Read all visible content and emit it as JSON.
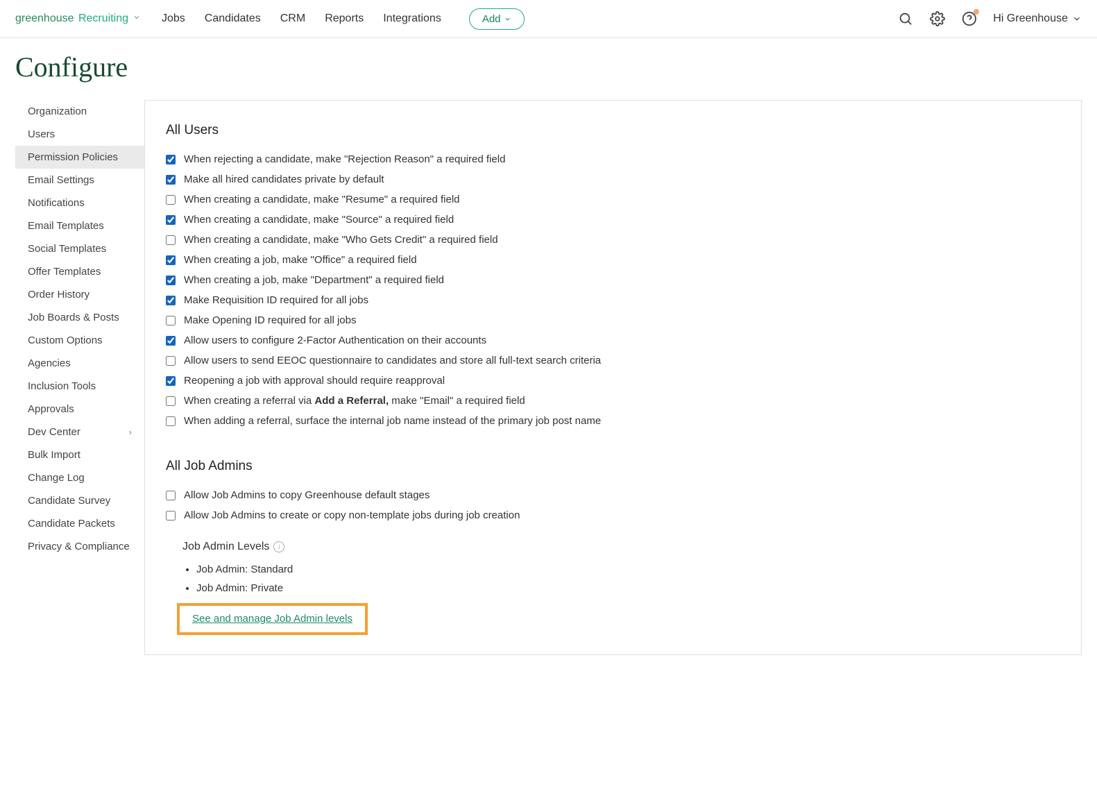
{
  "header": {
    "logo_brand": "greenhouse",
    "logo_product": "Recruiting",
    "nav": [
      "Jobs",
      "Candidates",
      "CRM",
      "Reports",
      "Integrations"
    ],
    "add_label": "Add",
    "user_greeting": "Hi Greenhouse"
  },
  "page_title": "Configure",
  "sidebar": {
    "items": [
      {
        "label": "Organization"
      },
      {
        "label": "Users"
      },
      {
        "label": "Permission Policies",
        "active": true
      },
      {
        "label": "Email Settings"
      },
      {
        "label": "Notifications"
      },
      {
        "label": "Email Templates"
      },
      {
        "label": "Social Templates"
      },
      {
        "label": "Offer Templates"
      },
      {
        "label": "Order History"
      },
      {
        "label": "Job Boards & Posts"
      },
      {
        "label": "Custom Options"
      },
      {
        "label": "Agencies"
      },
      {
        "label": "Inclusion Tools"
      },
      {
        "label": "Approvals"
      },
      {
        "label": "Dev Center",
        "chevron": true
      },
      {
        "label": "Bulk Import"
      },
      {
        "label": "Change Log"
      },
      {
        "label": "Candidate Survey"
      },
      {
        "label": "Candidate Packets"
      },
      {
        "label": "Privacy & Compliance"
      }
    ]
  },
  "sections": {
    "all_users": {
      "title": "All Users",
      "items": [
        {
          "checked": true,
          "label": "When rejecting a candidate, make \"Rejection Reason\" a required field"
        },
        {
          "checked": true,
          "label": "Make all hired candidates private by default"
        },
        {
          "checked": false,
          "label": "When creating a candidate, make \"Resume\" a required field"
        },
        {
          "checked": true,
          "label": "When creating a candidate, make \"Source\" a required field"
        },
        {
          "checked": false,
          "label": "When creating a candidate, make \"Who Gets Credit\" a required field"
        },
        {
          "checked": true,
          "label": "When creating a job, make \"Office\" a required field"
        },
        {
          "checked": true,
          "label": "When creating a job, make \"Department\" a required field"
        },
        {
          "checked": true,
          "label": "Make Requisition ID required for all jobs"
        },
        {
          "checked": false,
          "label": "Make Opening ID required for all jobs"
        },
        {
          "checked": true,
          "label": "Allow users to configure 2-Factor Authentication on their accounts"
        },
        {
          "checked": false,
          "label": "Allow users to send EEOC questionnaire to candidates and store all full-text search criteria"
        },
        {
          "checked": true,
          "label": "Reopening a job with approval should require reapproval"
        },
        {
          "checked": false,
          "pre": "When creating a referral via ",
          "bold": "Add a Referral,",
          "post": " make \"Email\" a required field"
        },
        {
          "checked": false,
          "label": "When adding a referral, surface the internal job name instead of the primary job post name"
        }
      ]
    },
    "all_job_admins": {
      "title": "All Job Admins",
      "items": [
        {
          "checked": false,
          "label": "Allow Job Admins to copy Greenhouse default stages"
        },
        {
          "checked": false,
          "label": "Allow Job Admins to create or copy non-template jobs during job creation"
        }
      ],
      "levels_title": "Job Admin Levels",
      "levels": [
        "Job Admin: Standard",
        "Job Admin: Private"
      ],
      "manage_link": "See and manage Job Admin levels"
    }
  }
}
